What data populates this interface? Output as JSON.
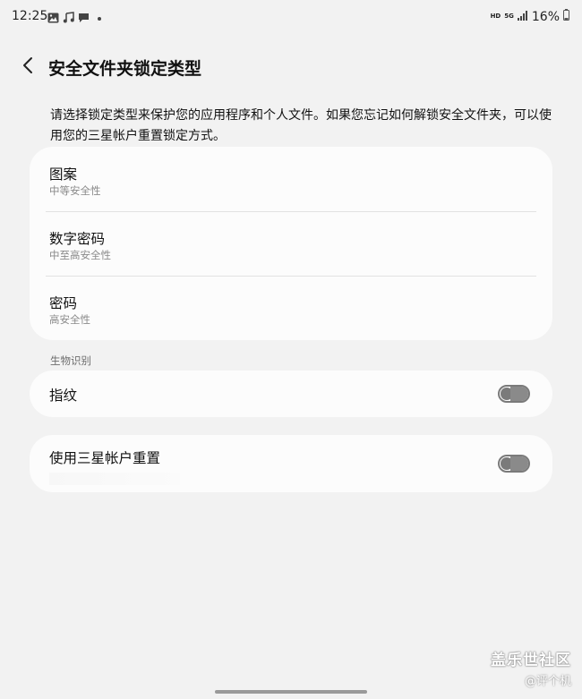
{
  "status_bar": {
    "time": "12:25",
    "left_icons": [
      "image-icon",
      "music-note-icon",
      "message-icon",
      "dot-icon"
    ],
    "hd_label": "HD",
    "network_label": "5G",
    "battery_text": "16%"
  },
  "header": {
    "title": "安全文件夹锁定类型"
  },
  "description": "请选择锁定类型来保护您的应用程序和个人文件。如果您忘记如何解锁安全文件夹，可以使用您的三星帐户重置锁定方式。",
  "lock_options": [
    {
      "title": "图案",
      "subtitle": "中等安全性"
    },
    {
      "title": "数字密码",
      "subtitle": "中至高安全性"
    },
    {
      "title": "密码",
      "subtitle": "高安全性"
    }
  ],
  "biometrics": {
    "section_label": "生物识别",
    "fingerprint_label": "指纹",
    "fingerprint_enabled": false
  },
  "samsung_reset": {
    "label": "使用三星帐户重置",
    "enabled": false
  },
  "watermark": {
    "brand": "盖乐世社区",
    "sub": "@评个机"
  },
  "colors": {
    "background": "#f2f2f2",
    "card": "#fcfcfc",
    "toggle_off": "#7a7a7a"
  }
}
